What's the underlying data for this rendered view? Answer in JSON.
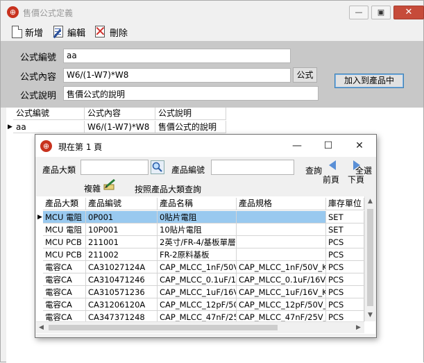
{
  "main": {
    "title": "售價公式定義",
    "toolbar": {
      "new_label": "新增",
      "edit_label": "編輯",
      "delete_label": "刪除"
    },
    "form": {
      "code_label": "公式編號",
      "code_value": "aa",
      "content_label": "公式內容",
      "content_value": "W6/(1-W7)*W8",
      "formula_button": "公式",
      "desc_label": "公式說明",
      "desc_value": "售價公式的說明",
      "add_to_product_button": "加入到產品中"
    },
    "grid": {
      "headers": [
        "公式編號",
        "公式內容",
        "公式說明"
      ],
      "rows": [
        [
          "aa",
          "W6/(1-W7)*W8",
          "售價公式的說明"
        ]
      ]
    }
  },
  "dialog": {
    "title": "現在第 1 頁",
    "category_label": "產品大類",
    "product_code_label": "產品編號",
    "query_label": "查詢",
    "copy_label": "複雜",
    "category_query_label": "按照產品大類查詢",
    "prev_label": "前頁",
    "next_label": "下頁",
    "select_all_label": "全選",
    "grid": {
      "headers": [
        "產品大類",
        "產品編號",
        "產品名稱",
        "產品規格",
        "庫存單位"
      ],
      "rows": [
        [
          "MCU 電阻",
          "0P001",
          "0貼片電阻",
          "",
          "SET"
        ],
        [
          "MCU 電阻",
          "10P001",
          "10貼片電阻",
          "",
          "SET"
        ],
        [
          "MCU PCB",
          "211001",
          "2英寸/FR-4/基板單層",
          "",
          "PCS"
        ],
        [
          "MCU PCB",
          "211002",
          "FR-2原料基板",
          "",
          "PCS"
        ],
        [
          "電容CA",
          "CA31027124A",
          "CAP_MLCC_1nF/50V_",
          "CAP_MLCC_1nF/50V_K_",
          "PCS"
        ],
        [
          "電容CA",
          "CA310471246",
          "CAP_MLCC_0.1uF/16V",
          "CAP_MLCC_0.1uF/16V_K",
          "PCS"
        ],
        [
          "電容CA",
          "CA310571236",
          "CAP_MLCC_1uF/16V_",
          "CAP_MLCC_1uF/16V_K_",
          "PCS"
        ],
        [
          "電容CA",
          "CA31206120A",
          "CAP_MLCC_12pF/50V",
          "CAP_MLCC_12pF/50V_J_",
          "PCS"
        ],
        [
          "電容CA",
          "CA347371248",
          "CAP_MLCC_47nF/25V",
          "CAP_MLCC_47nF/25V_J_",
          "PCS"
        ]
      ]
    }
  }
}
